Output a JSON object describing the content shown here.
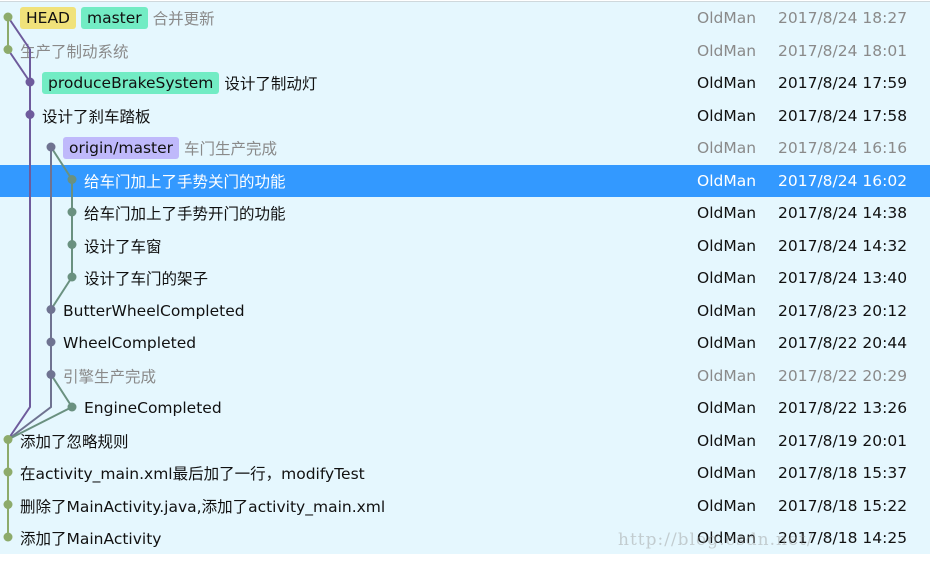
{
  "colors": {
    "background": "#e5f7fe",
    "selected": "#3399ff",
    "lanes": [
      "#8dab6b",
      "#6e5b9c",
      "#6f7391",
      "#6a9180"
    ],
    "tags": {
      "HEAD": "#f0e27a",
      "master": "#72ecc4",
      "produceBrakeSystem": "#72ecc4",
      "origin/master": "#bfb9fb"
    }
  },
  "commits": [
    {
      "lane": 0,
      "tags": [
        "HEAD",
        "master"
      ],
      "message": "合并更新",
      "author": "OldMan",
      "date": "2017/8/24 18:27",
      "dim": true
    },
    {
      "lane": 0,
      "tags": [],
      "message": "生产了制动系统",
      "author": "OldMan",
      "date": "2017/8/24 18:01",
      "dim": true
    },
    {
      "lane": 1,
      "tags": [
        "produceBrakeSystem"
      ],
      "message": "设计了制动灯",
      "author": "OldMan",
      "date": "2017/8/24 17:59"
    },
    {
      "lane": 1,
      "tags": [],
      "message": "设计了刹车踏板",
      "author": "OldMan",
      "date": "2017/8/24 17:58"
    },
    {
      "lane": 2,
      "tags": [
        "origin/master"
      ],
      "message": "车门生产完成",
      "author": "OldMan",
      "date": "2017/8/24 16:16",
      "dim": true
    },
    {
      "lane": 3,
      "tags": [],
      "message": "给车门加上了手势关门的功能",
      "author": "OldMan",
      "date": "2017/8/24 16:02",
      "selected": true
    },
    {
      "lane": 3,
      "tags": [],
      "message": "给车门加上了手势开门的功能",
      "author": "OldMan",
      "date": "2017/8/24 14:38"
    },
    {
      "lane": 3,
      "tags": [],
      "message": "设计了车窗",
      "author": "OldMan",
      "date": "2017/8/24 14:32"
    },
    {
      "lane": 3,
      "tags": [],
      "message": "设计了车门的架子",
      "author": "OldMan",
      "date": "2017/8/24 13:40"
    },
    {
      "lane": 2,
      "tags": [],
      "message": "ButterWheelCompleted",
      "author": "OldMan",
      "date": "2017/8/23 20:12"
    },
    {
      "lane": 2,
      "tags": [],
      "message": "WheelCompleted",
      "author": "OldMan",
      "date": "2017/8/22 20:44"
    },
    {
      "lane": 2,
      "tags": [],
      "message": "引擎生产完成",
      "author": "OldMan",
      "date": "2017/8/22 20:29",
      "dim": true
    },
    {
      "lane": 3,
      "tags": [],
      "message": "EngineCompleted",
      "author": "OldMan",
      "date": "2017/8/22 13:26"
    },
    {
      "lane": 0,
      "tags": [],
      "message": "添加了忽略规则",
      "author": "OldMan",
      "date": "2017/8/19 20:01"
    },
    {
      "lane": 0,
      "tags": [],
      "message": "在activity_main.xml最后加了一行，modifyTest",
      "author": "OldMan",
      "date": "2017/8/18 15:37"
    },
    {
      "lane": 0,
      "tags": [],
      "message": "删除了MainActivity.java,添加了activity_main.xml",
      "author": "OldMan",
      "date": "2017/8/18 15:22"
    },
    {
      "lane": 0,
      "tags": [],
      "message": "添加了MainActivity",
      "author": "OldMan",
      "date": "2017/8/18 14:25"
    }
  ],
  "edges": [
    [
      0,
      1
    ],
    [
      0,
      2
    ],
    [
      1,
      2
    ],
    [
      2,
      3
    ],
    [
      3,
      13
    ],
    [
      4,
      9
    ],
    [
      4,
      5
    ],
    [
      5,
      6
    ],
    [
      6,
      7
    ],
    [
      7,
      8
    ],
    [
      8,
      9
    ],
    [
      9,
      10
    ],
    [
      10,
      11
    ],
    [
      11,
      13
    ],
    [
      11,
      12
    ],
    [
      12,
      13
    ],
    [
      13,
      14
    ],
    [
      14,
      15
    ],
    [
      15,
      16
    ]
  ],
  "watermark": "http://blog.csdn.net/"
}
